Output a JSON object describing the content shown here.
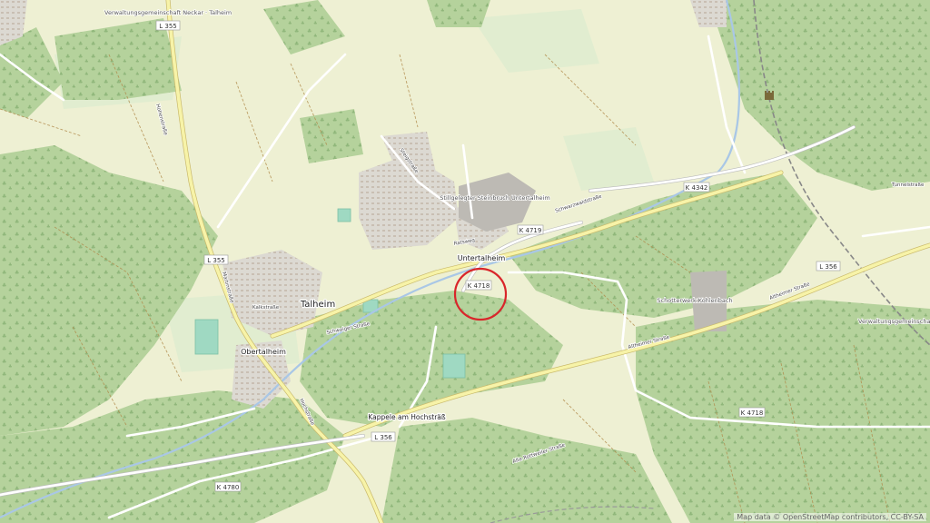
{
  "map": {
    "places": {
      "untertalheim": "Untertalheim",
      "talheim": "Talheim",
      "obertalheim": "Obertalheim",
      "kappele": "Kappele am Hochsträß",
      "steinbruch": "Stillgelegter Steinbruch Untertalheim",
      "schotterwerk": "Schotterwerk Kohlenbach",
      "verwaltung_top": "Verwaltungsgemeinschaft Neckar · Talheim",
      "verwaltung_right": "Verwaltungsgemeinschaft"
    },
    "road_refs": {
      "l355_top": "L 355",
      "l355_mid": "L 355",
      "l356_right": "L 356",
      "l356_bottom": "L 356",
      "k4342": "K 4342",
      "k4719": "K 4719",
      "k4718_center": "K 4718",
      "k4718_right": "K 4718",
      "k4780": "K 4780"
    },
    "streets": {
      "schwarzwaldstrasse": "Schwarzwaldstraße",
      "hohenstrasse": "Hohenstraße",
      "altheimer_right": "Altheimer Straße",
      "altheimer_bottom": "Altheimer Straße",
      "kalkstrasse": "Kalkstraße",
      "martinstrasse": "Martinstraße",
      "schwaiger": "Schwaiger Straße",
      "tunnelstrasse": "Tunnelstraße",
      "alte_rottweiler": "Alte Rottweiler Straße",
      "hochstrasse": "Hochstraße",
      "steigstrasse": "Steigstraße",
      "ratsweg": "Ratsweg"
    },
    "marker": {
      "color": "#d9262b",
      "label": "location-marker"
    },
    "attribution": "Map data © OpenStreetMap contributors, CC-BY-SA"
  }
}
